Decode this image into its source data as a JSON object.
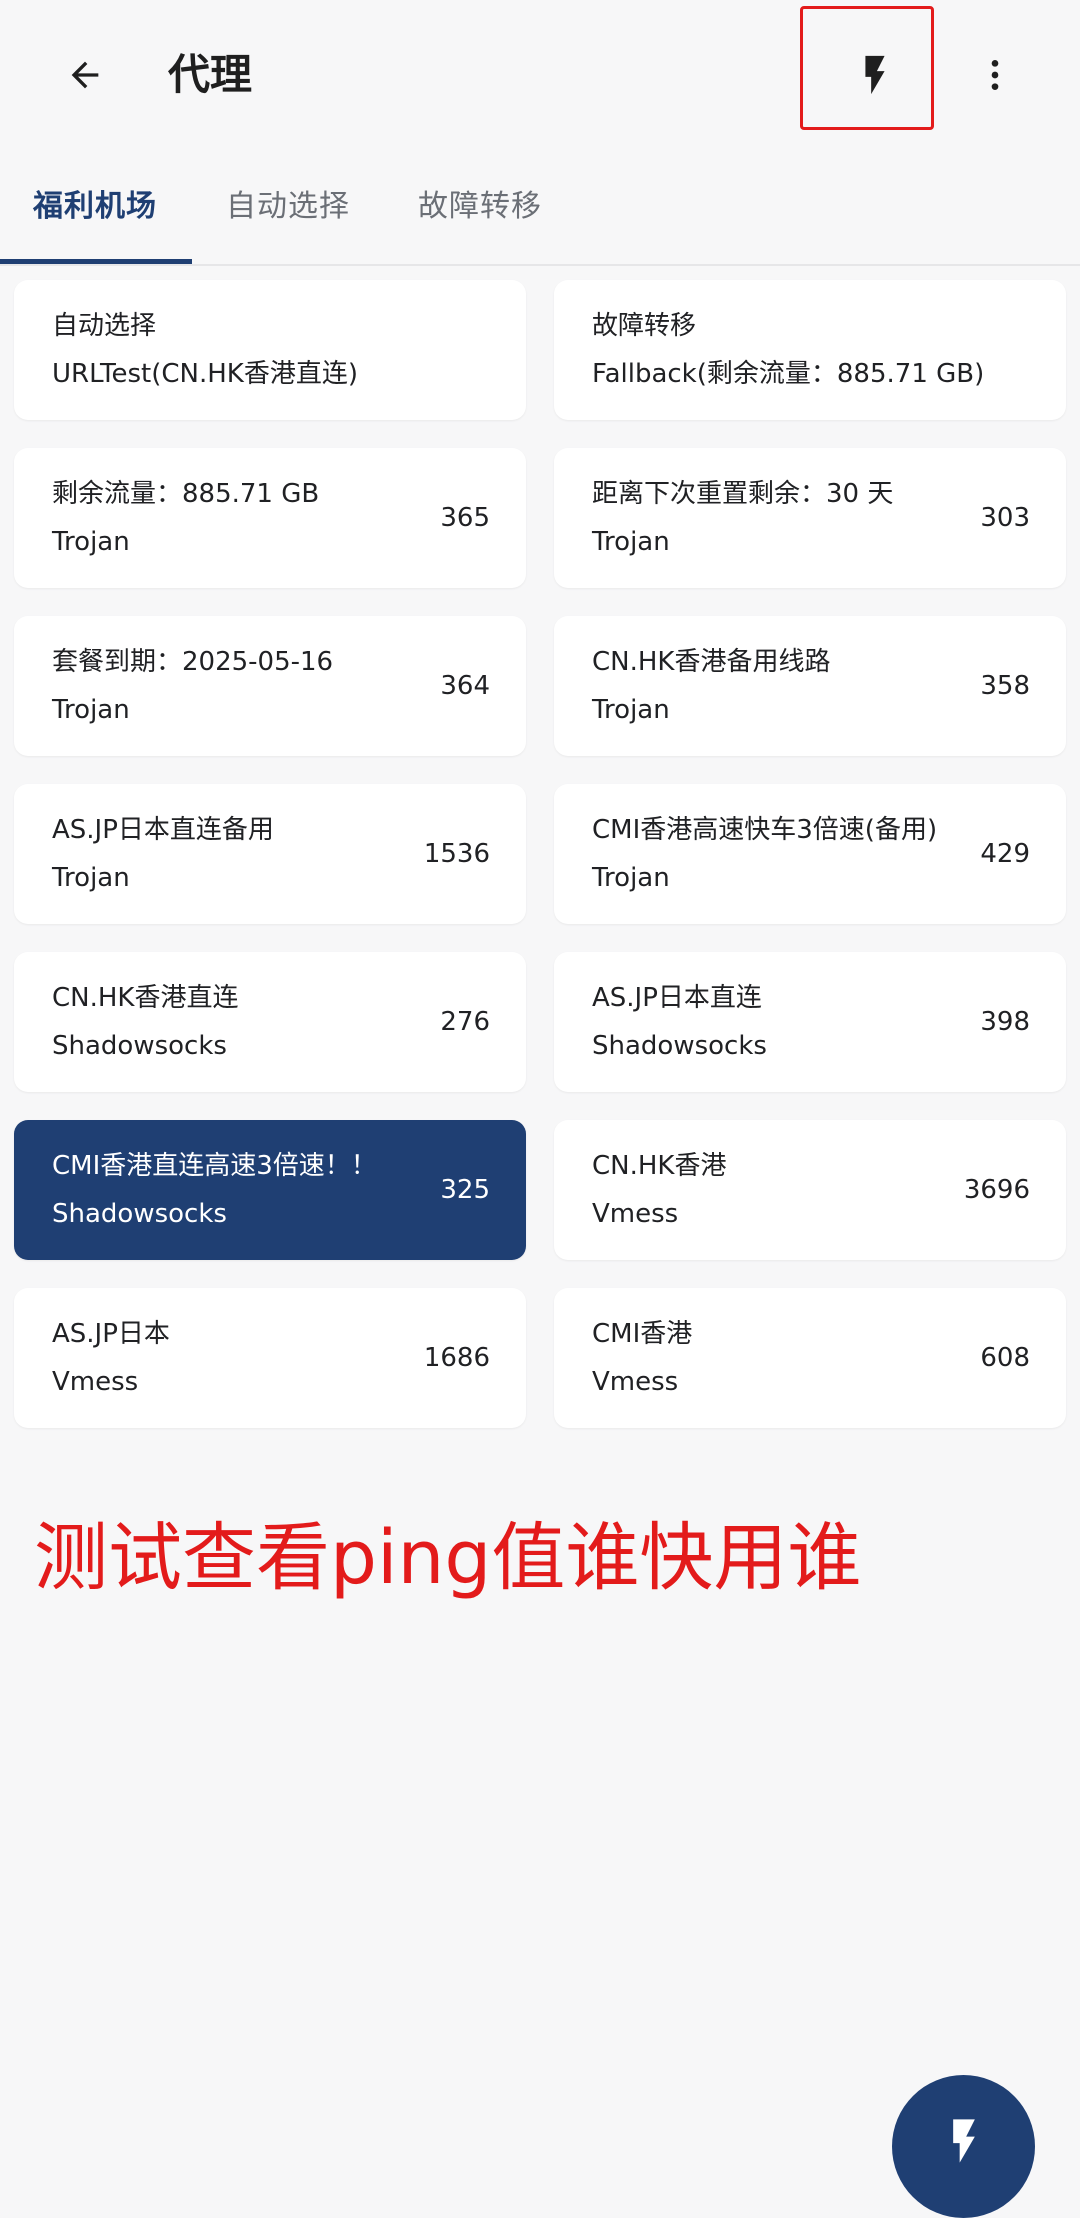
{
  "appbar": {
    "back_icon": "arrow-left-icon",
    "title": "代理",
    "test_icon": "flash-icon",
    "more_icon": "more-vert-icon"
  },
  "tabs": [
    {
      "label": "福利机场",
      "active": true
    },
    {
      "label": "自动选择",
      "active": false
    },
    {
      "label": "故障转移",
      "active": false
    }
  ],
  "proxies": [
    {
      "name": "自动选择",
      "type": "URLTest(CN.HK香港直连)",
      "latency": ""
    },
    {
      "name": "故障转移",
      "type": "Fallback(剩余流量：885.71 GB)",
      "latency": ""
    },
    {
      "name": "剩余流量：885.71 GB",
      "type": "Trojan",
      "latency": "365"
    },
    {
      "name": "距离下次重置剩余：30 天",
      "type": "Trojan",
      "latency": "303"
    },
    {
      "name": "套餐到期：2025-05-16",
      "type": "Trojan",
      "latency": "364"
    },
    {
      "name": "CN.HK香港备用线路",
      "type": "Trojan",
      "latency": "358"
    },
    {
      "name": "AS.JP日本直连备用",
      "type": "Trojan",
      "latency": "1536"
    },
    {
      "name": "CMI香港高速快车3倍速(备用)",
      "type": "Trojan",
      "latency": "429"
    },
    {
      "name": "CN.HK香港直连",
      "type": "Shadowsocks",
      "latency": "276"
    },
    {
      "name": "AS.JP日本直连",
      "type": "Shadowsocks",
      "latency": "398"
    },
    {
      "name": "CMI香港直连高速3倍速！！",
      "type": "Shadowsocks",
      "latency": "325",
      "selected": true
    },
    {
      "name": "CN.HK香港",
      "type": "Vmess",
      "latency": "3696"
    },
    {
      "name": "AS.JP日本",
      "type": "Vmess",
      "latency": "1686"
    },
    {
      "name": "CMI香港",
      "type": "Vmess",
      "latency": "608"
    }
  ],
  "annotation": "测试查看ping值谁快用谁",
  "fab": {
    "icon": "flash-icon"
  },
  "colors": {
    "accent": "#1f3f73",
    "highlight": "#e31b1b",
    "background": "#f7f7f8",
    "card": "#ffffff"
  }
}
